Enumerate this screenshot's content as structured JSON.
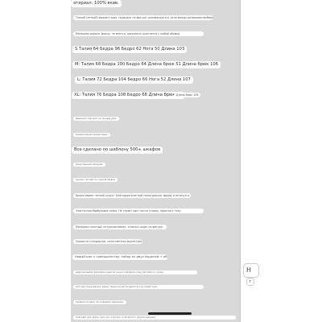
{
  "material": "атериал: 100% вкив.",
  "info_line": "Тонкий (летний) вариант кроя, подходит по фигуре, рекомендуется, если между размерами выбирать больший, отлично сидит.",
  "notice_line": "Материал держит форму, не мнется, прекрасно сочетается с любой обувью.",
  "sizes": {
    "s": "S Талия 64 Бедра 96 Бедро 62 Нога 50 Длина 103",
    "m": "M: Талия 68 Бедра 100 Бедро 64 Длина брюк 51 Длина брюк 106",
    "l": "L: Талия 72 Бедра 104 Бедро 66 Нога 52 Длина 107",
    "xl": "XL: Талия 76 Бедра 108 Бедро 68 Длина брюк 53",
    "xl_extra": "Длина брюк 108"
  },
  "small_a": "Идеально подходят на каждый день",
  "small_b": "Универсальная модель брюк",
  "headline": "Все сделано по шаблону 500+ шкафов",
  "small_c": "Качественный материал",
  "small_d": "Хорошо смотрятся с разной обувью",
  "line_1": "Брюки имеют четкий силуэт. Благодаря плотной ткани держат форму и не мнутся.",
  "line_2": "Эластичная бамбуковая ткань. Не теряет цвет после стирки, приятно к телу.",
  "line_3": "Материал плотный, не просвечивает, отлично сидит по фигуре.",
  "line_4": "Пошив по стандартам, качественная фурнитура.",
  "line_5": "Новый шаг к совершенству: набор из двух моделей + обувь.",
  "line_6": "Широкий выбор размеров и цветов, можно подобрать пару для любого случая.",
  "line_7": "Плотная ткань держит форму, брюки не растягиваются и не теряют вид.",
  "line_8": "Удобная посадка, не сковывают движения.",
  "line_9": "Подходят для офиса, прогулок и встреч, сочетаются с разной одеждой.",
  "right_letter": "Н",
  "right_small": "г"
}
